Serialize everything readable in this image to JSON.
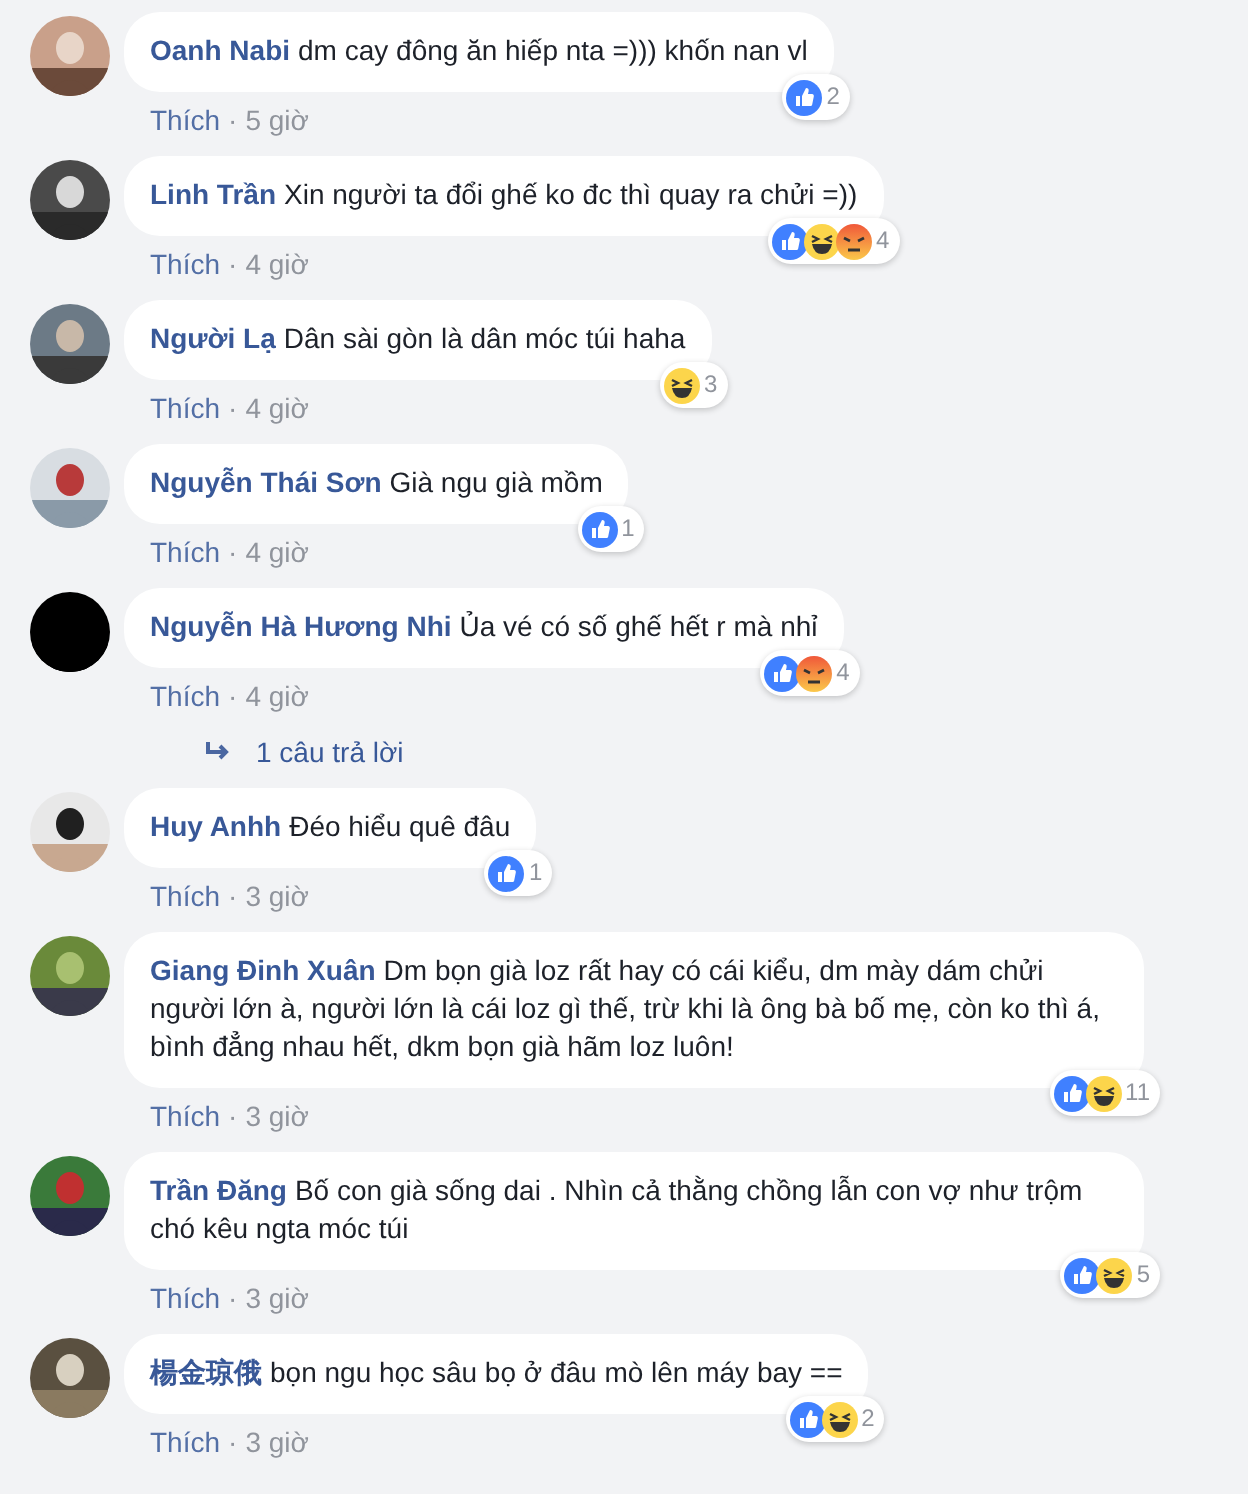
{
  "comments": [
    {
      "author": "Oanh Nabi",
      "text": "dm cay đông ăn hiếp nta =))) khốn nan vl",
      "reactions": [
        {
          "kind": "like"
        }
      ],
      "reaction_count": "2",
      "like_label": "Thích",
      "separator": "·",
      "time": "5 giờ"
    },
    {
      "author": "Linh Trần",
      "text": "Xin người ta đổi ghế ko đc thì quay ra chửi =))",
      "reactions": [
        {
          "kind": "like"
        },
        {
          "kind": "haha"
        },
        {
          "kind": "angry"
        }
      ],
      "reaction_count": "4",
      "like_label": "Thích",
      "separator": "·",
      "time": "4 giờ"
    },
    {
      "author": "Người Lạ",
      "text": "Dân sài gòn là dân móc túi haha",
      "reactions": [
        {
          "kind": "haha"
        }
      ],
      "reaction_count": "3",
      "like_label": "Thích",
      "separator": "·",
      "time": "4 giờ"
    },
    {
      "author": "Nguyễn Thái Sơn",
      "text": "Già ngu già mồm",
      "reactions": [
        {
          "kind": "like"
        }
      ],
      "reaction_count": "1",
      "like_label": "Thích",
      "separator": "·",
      "time": "4 giờ"
    },
    {
      "author": "Nguyễn Hà Hương Nhi",
      "text": "Ủa vé có số ghế hết r mà nhỉ",
      "reactions": [
        {
          "kind": "like"
        },
        {
          "kind": "angry"
        }
      ],
      "reaction_count": "4",
      "like_label": "Thích",
      "separator": "·",
      "time": "4 giờ",
      "replies": "1 câu trả lời"
    },
    {
      "author": "Huy Anhh",
      "text": "Đéo hiểu quê đâu",
      "reactions": [
        {
          "kind": "like"
        }
      ],
      "reaction_count": "1",
      "like_label": "Thích",
      "separator": "·",
      "time": "3 giờ"
    },
    {
      "author": "Giang Đinh Xuân",
      "text": "Dm bọn già loz rất hay có cái kiểu, dm mày dám chửi người lớn à, người lớn là cái loz gì thế, trừ khi là ông bà bố mẹ, còn ko thì á, bình đẳng nhau hết, dkm bọn già hãm loz luôn!",
      "reactions": [
        {
          "kind": "like"
        },
        {
          "kind": "haha"
        }
      ],
      "reaction_count": "11",
      "like_label": "Thích",
      "separator": "·",
      "time": "3 giờ"
    },
    {
      "author": "Trần Đăng",
      "text": "Bố con già sống dai . Nhìn cả thằng chồng lẫn con vợ như trộm chó kêu ngta móc túi",
      "reactions": [
        {
          "kind": "like"
        },
        {
          "kind": "haha"
        }
      ],
      "reaction_count": "5",
      "like_label": "Thích",
      "separator": "·",
      "time": "3 giờ"
    },
    {
      "author": "楊金琼俄",
      "text": "bọn ngu học sâu bọ ở đâu mò lên máy bay ==",
      "reactions": [
        {
          "kind": "like"
        },
        {
          "kind": "haha"
        }
      ],
      "reaction_count": "2",
      "like_label": "Thích",
      "separator": "·",
      "time": "3 giờ"
    }
  ]
}
